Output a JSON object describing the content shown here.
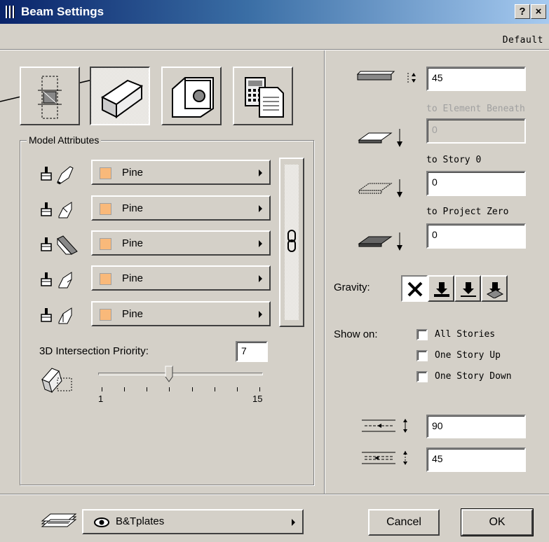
{
  "window": {
    "title": "Beam Settings",
    "help_label": "?",
    "close_label": "×",
    "preset": "Default"
  },
  "tools": [
    {
      "icon": "beam-plan-icon"
    },
    {
      "icon": "beam-3d-icon",
      "selected": true
    },
    {
      "icon": "beam-hole-icon"
    },
    {
      "icon": "beam-listing-icon"
    }
  ],
  "model_attributes": {
    "group_label": "Model Attributes",
    "materials": [
      "Pine",
      "Pine",
      "Pine",
      "Pine",
      "Pine"
    ],
    "swatch_color": "#f9b97a",
    "intersection_label": "3D Intersection Priority:",
    "intersection_value": "7",
    "slider": {
      "min": "1",
      "max": "15",
      "value": 7
    }
  },
  "geometry": {
    "height_value": "45",
    "to_element_beneath_label": "to Element Beneath",
    "to_element_beneath_value": "0",
    "to_story_label": "to Story 0",
    "to_story_value": "0",
    "to_project_zero_label": "to Project Zero",
    "to_project_zero_value": "0"
  },
  "gravity": {
    "label": "Gravity:"
  },
  "show_on": {
    "label": "Show on:",
    "options": [
      "All Stories",
      "One Story Up",
      "One Story Down"
    ]
  },
  "section": {
    "width_value": "90",
    "offset_value": "45"
  },
  "footer": {
    "layer_name": "B&Tplates",
    "cancel_label": "Cancel",
    "ok_label": "OK"
  }
}
